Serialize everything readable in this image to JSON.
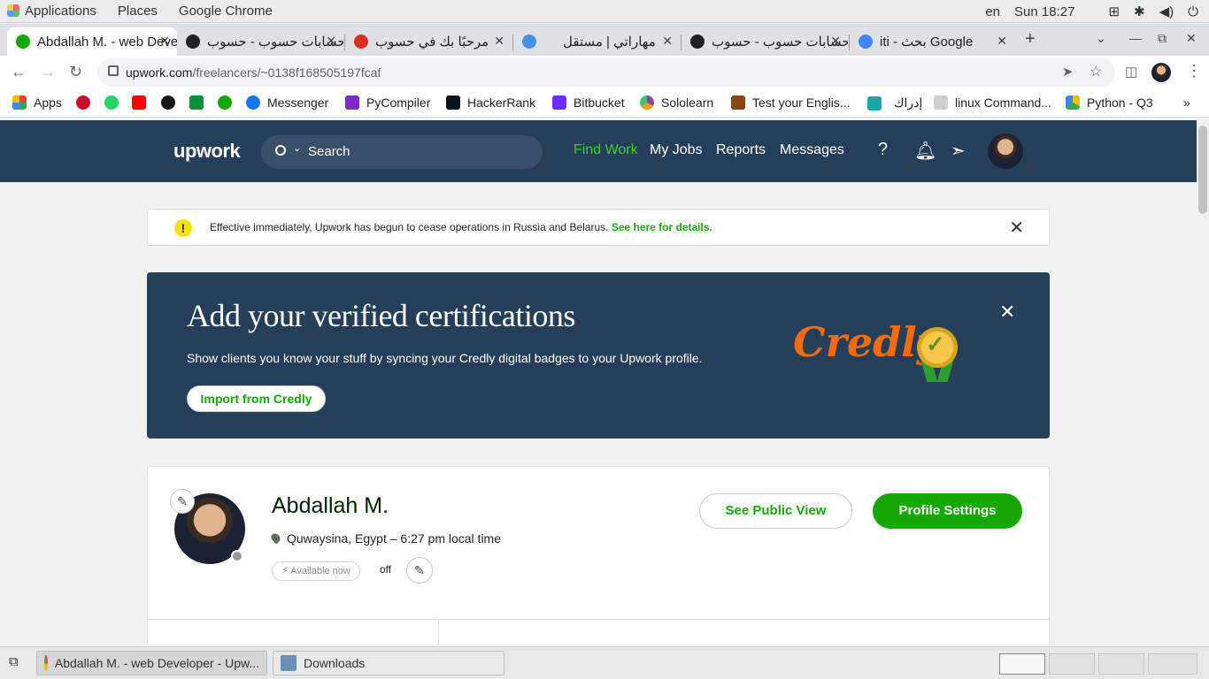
{
  "system": {
    "menus": [
      "Applications",
      "Places",
      "Google Chrome"
    ],
    "lang": "en",
    "clock": "Sun 18:27"
  },
  "browser": {
    "tabs": [
      {
        "title": "Abdallah M. - web Developer - Upwork",
        "color": "#14a800"
      },
      {
        "title": "حسابات حسوب - حسوب",
        "color": "#222222"
      },
      {
        "title": "مرحبًا بك في حسوب",
        "color": "#d93025"
      },
      {
        "title": "مهاراتي | مستقل",
        "color": "#4a90e2"
      },
      {
        "title": "حسابات حسوب - حسوب",
        "color": "#222222"
      },
      {
        "title": "iti - بحث Google",
        "color": "#4285f4"
      }
    ],
    "url_host": "upwork.com",
    "url_path": "/freelancers/~0138f168505197fcaf",
    "bookmarks": [
      {
        "label": "Apps",
        "icon": "apps-grid-icon",
        "color": "#4285f4"
      },
      {
        "label": "",
        "icon": "uk-flag-icon",
        "color": "#c8102e"
      },
      {
        "label": "",
        "icon": "whatsapp-icon",
        "color": "#25d366"
      },
      {
        "label": "",
        "icon": "youtube-icon",
        "color": "#ff0000"
      },
      {
        "label": "",
        "icon": "github-icon",
        "color": "#181717"
      },
      {
        "label": "",
        "icon": "wuzzuf-icon",
        "color": "#0a8f3c"
      },
      {
        "label": "",
        "icon": "upwork-icon",
        "color": "#14a800"
      },
      {
        "label": "Messenger",
        "icon": "facebook-icon",
        "color": "#1877f2"
      },
      {
        "label": "PyCompiler",
        "icon": "pycompiler-icon",
        "color": "#7b2cbf"
      },
      {
        "label": "HackerRank",
        "icon": "hackerrank-icon",
        "color": "#0e141e"
      },
      {
        "label": "Bitbucket",
        "icon": "bitbucket-icon",
        "color": "#6e2cff"
      },
      {
        "label": "Sololearn",
        "icon": "sololearn-icon",
        "color": "#8e44ad"
      },
      {
        "label": "Test your Englis...",
        "icon": "cambridge-icon",
        "color": "#8b4513"
      },
      {
        "label": "إدراك",
        "icon": "edraak-icon",
        "color": "#1aa6a6"
      },
      {
        "label": "linux Command...",
        "icon": "page-icon",
        "color": "#cfcfcf"
      },
      {
        "label": "Python - Q3",
        "icon": "drive-icon",
        "color": "#fbbc04"
      }
    ]
  },
  "upwork": {
    "logo": "upwork",
    "search_placeholder": "Search",
    "nav": [
      "Find Work",
      "My Jobs",
      "Reports",
      "Messages"
    ],
    "alert_text": "Effective immediately, Upwork has begun to cease operations in Russia and Belarus.",
    "alert_link": "See here for details.",
    "banner_title": "Add your verified certifications",
    "banner_sub": "Show clients you know your stuff by syncing your Credly digital badges to your Upwork profile.",
    "banner_button": "Import from Credly",
    "credly_logo": "Credly",
    "profile_name": "Abdallah M.",
    "profile_location": "Quwaysina, Egypt – 6:27 pm local time",
    "availability": "Available now",
    "availability_state": "off",
    "public_view_button": "See Public View",
    "settings_button": "Profile Settings"
  },
  "taskbar": {
    "tasks": [
      "Abdallah M. - web Developer - Upw...",
      "Downloads"
    ]
  }
}
